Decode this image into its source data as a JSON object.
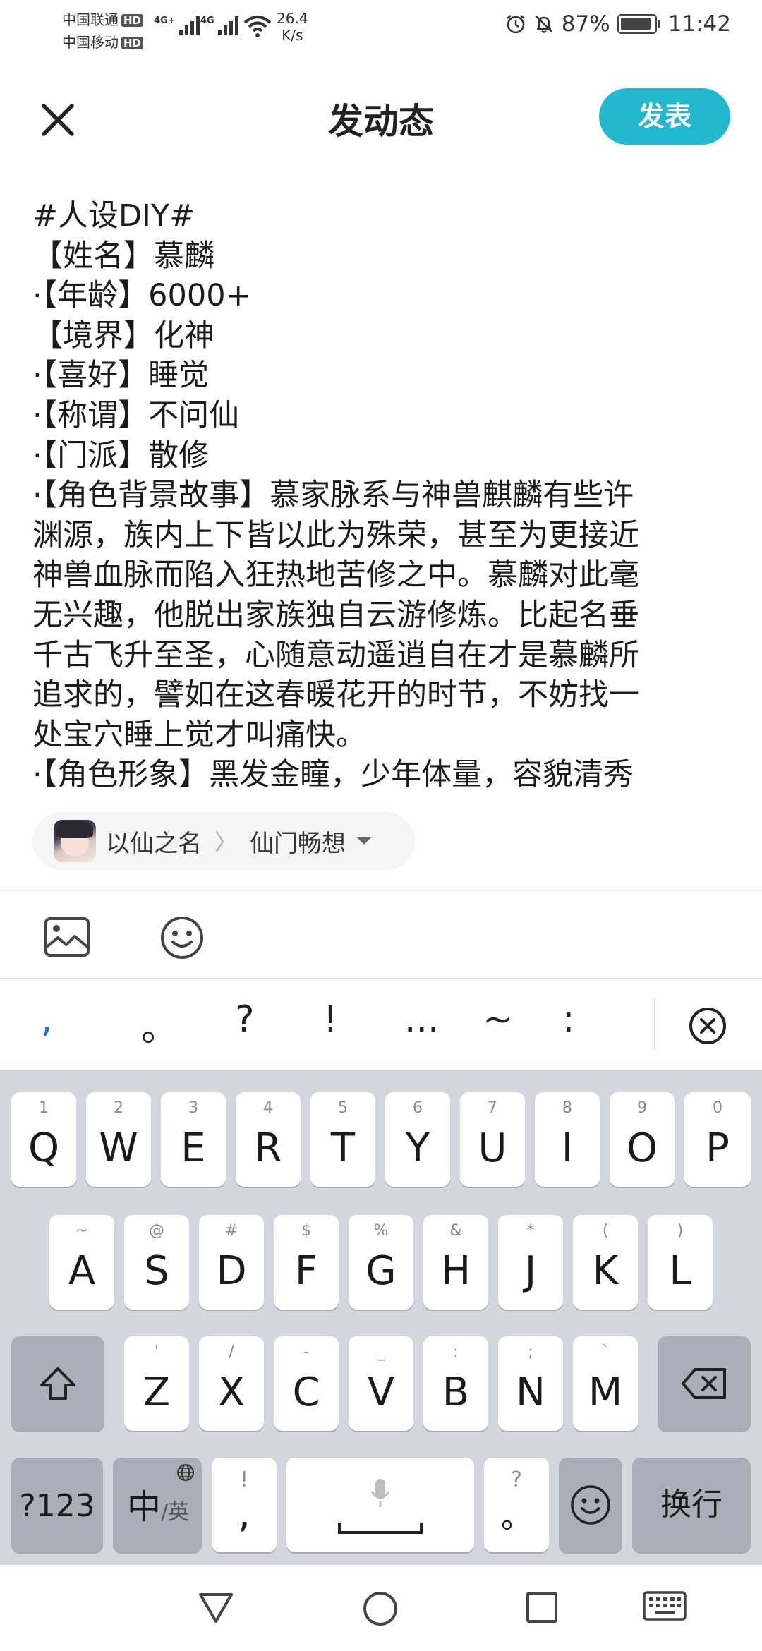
{
  "status_bar": {
    "carrier1": "中国联通",
    "carrier2": "中国移动",
    "hd_badge": "HD",
    "signal1_label": "4G+",
    "signal2_label": "4G",
    "net_speed_value": "26.4",
    "net_speed_unit": "K/s",
    "battery_percent": "87%",
    "time": "11:42"
  },
  "header": {
    "title": "发动态",
    "publish_label": "发表"
  },
  "editor": {
    "lines": [
      "#人设DIY#",
      "【姓名】慕麟",
      "·【年龄】6000+",
      "【境界】化神",
      "·【喜好】睡觉",
      "·【称谓】不问仙",
      "·【门派】散修",
      "·【角色背景故事】慕家脉系与神兽麒麟有些许",
      "渊源，族内上下皆以此为殊荣，甚至为更接近",
      "神兽血脉而陷入狂热地苦修之中。慕麟对此毫",
      "无兴趣，他脱出家族独自云游修炼。比起名垂",
      "千古飞升至圣，心随意动遥逍自在才是慕麟所",
      "追求的，譬如在这春暖花开的时节，不妨找一",
      "处宝穴睡上觉才叫痛快。",
      "·【角色形象】黑发金瞳，少年体量，容貌清秀"
    ]
  },
  "topic": {
    "name": "以仙之名",
    "separator": "〉",
    "sub": "仙门畅想"
  },
  "punctuation": [
    ",",
    "。",
    "?",
    "!",
    "...",
    "~",
    ":"
  ],
  "keyboard": {
    "row1": [
      {
        "key": "Q",
        "hint": "1"
      },
      {
        "key": "W",
        "hint": "2"
      },
      {
        "key": "E",
        "hint": "3"
      },
      {
        "key": "R",
        "hint": "4"
      },
      {
        "key": "T",
        "hint": "5"
      },
      {
        "key": "Y",
        "hint": "6"
      },
      {
        "key": "U",
        "hint": "7"
      },
      {
        "key": "I",
        "hint": "8"
      },
      {
        "key": "O",
        "hint": "9"
      },
      {
        "key": "P",
        "hint": "0"
      }
    ],
    "row2": [
      {
        "key": "A",
        "hint": "~"
      },
      {
        "key": "S",
        "hint": "@"
      },
      {
        "key": "D",
        "hint": "#"
      },
      {
        "key": "F",
        "hint": "$"
      },
      {
        "key": "G",
        "hint": "%"
      },
      {
        "key": "H",
        "hint": "&"
      },
      {
        "key": "J",
        "hint": "*"
      },
      {
        "key": "K",
        "hint": "("
      },
      {
        "key": "L",
        "hint": ")"
      }
    ],
    "row3": [
      {
        "key": "Z",
        "hint": "'"
      },
      {
        "key": "X",
        "hint": "/"
      },
      {
        "key": "C",
        "hint": "-"
      },
      {
        "key": "V",
        "hint": "_"
      },
      {
        "key": "B",
        "hint": ":"
      },
      {
        "key": "N",
        "hint": ";"
      },
      {
        "key": "M",
        "hint": "`"
      }
    ],
    "symbols_label": "?123",
    "lang_main": "中",
    "lang_sub": "/英",
    "comma_main": ",",
    "comma_hint": "!",
    "period_main": "。",
    "period_hint": "?",
    "enter_label": "换行"
  },
  "icons": {
    "close": "close-icon",
    "image": "image-icon",
    "emoji": "emoji-icon",
    "shift": "shift-icon",
    "backspace": "backspace-icon",
    "mic": "mic-icon",
    "globe": "globe-icon",
    "clear": "clear-icon",
    "alarm": "alarm-icon",
    "mute": "bell-off-icon"
  },
  "colors": {
    "accent": "#22b8cf",
    "keyboard_bg": "#d3d6dc",
    "key_gray": "#a9aeb8"
  }
}
